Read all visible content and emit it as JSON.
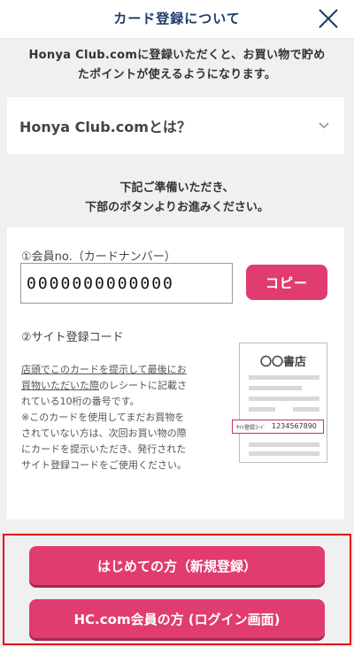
{
  "header": {
    "title": "カード登録について",
    "close_icon": "close-icon"
  },
  "intro": {
    "line1": "Honya Club.comに登録いただくと、お買い物で貯め",
    "line2": "たポイントが使えるようになります。"
  },
  "faq": {
    "question": "Honya Club.comとは？",
    "icon": "chevron-down-icon"
  },
  "prepare": {
    "line1": "下記ご準備いただき、",
    "line2": "下部のボタンよりお進みください。"
  },
  "member": {
    "label": "①会員no.（カードナンバー）",
    "value": "0000000000000",
    "copy_label": "コピー"
  },
  "site_code": {
    "label": "②サイト登録コード",
    "desc_line1": "店頭でこのカードを提示して最後にお",
    "desc_line2": "買物いただいた際",
    "desc_line2b": "のレシートに記載さ",
    "desc_line3": "れている10桁の番号です。",
    "desc_line4": "※このカードを使用してまだお買物を",
    "desc_line5": "されていない方は、次回お買い物の際",
    "desc_line6": "にカードを提示いただき、発行された",
    "desc_line7": "サイト登録コードをご使用ください。"
  },
  "receipt": {
    "store": "〇〇書店",
    "code_label": "ｻｲﾄ登録ｺｰﾄﾞ",
    "code_value": "1234567890"
  },
  "actions": {
    "new_register_label": "はじめての方（新規登録）",
    "login_label": "HC.com会員の方 (ログイン画面)"
  },
  "colors": {
    "accent": "#e13c6f",
    "title": "#1c3a6b",
    "highlight": "#e60012"
  }
}
